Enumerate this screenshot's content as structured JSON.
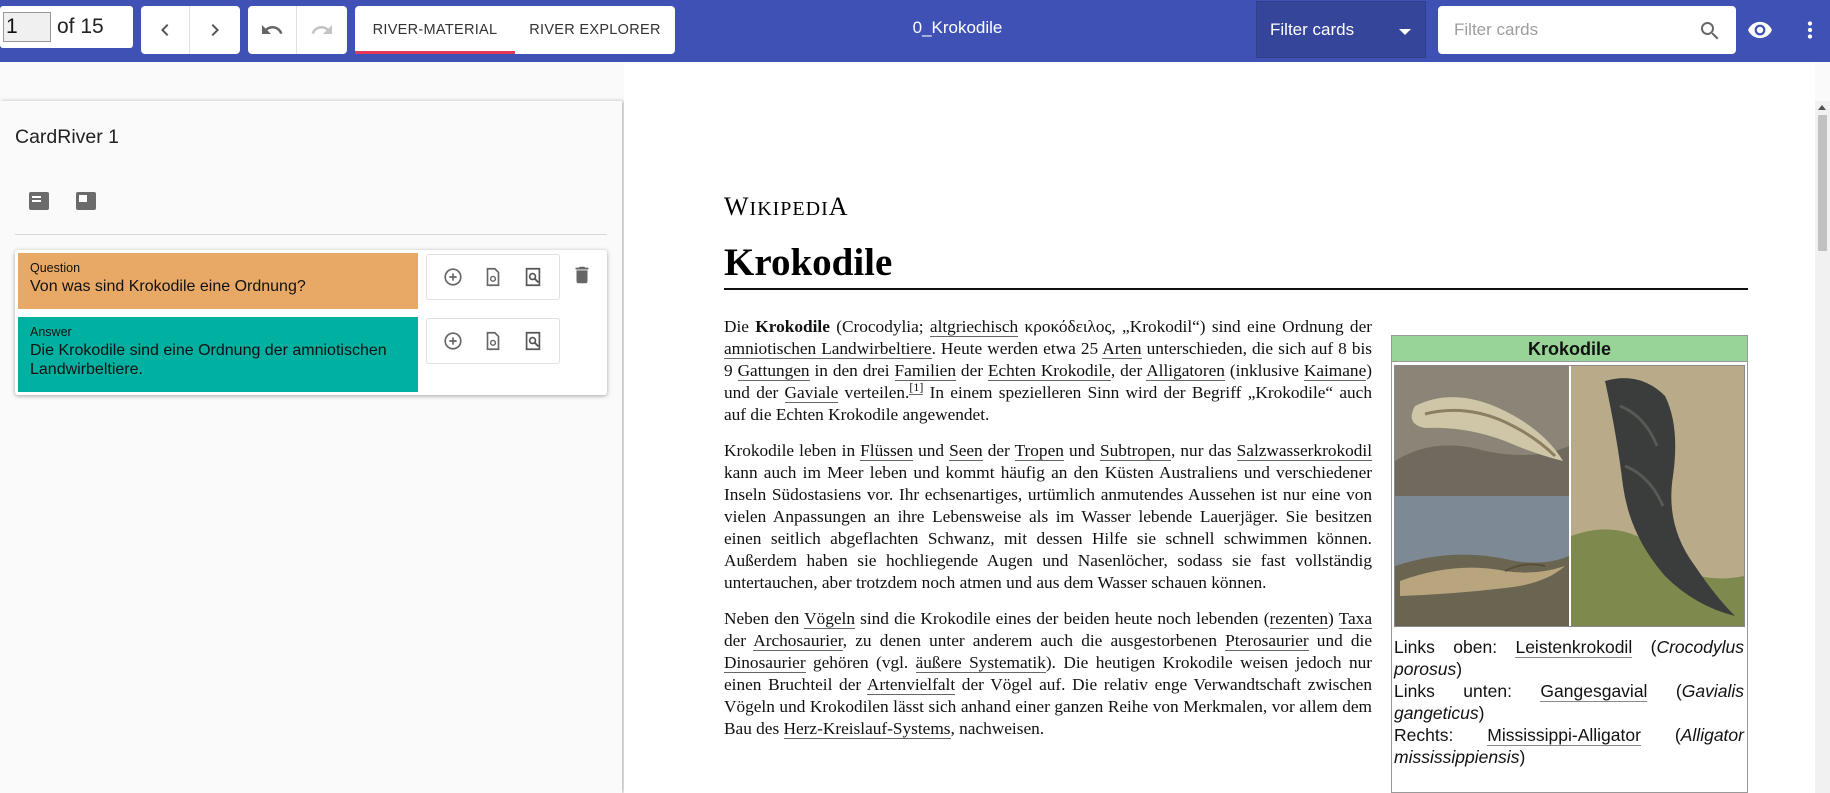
{
  "toolbar": {
    "page_current": "1",
    "page_total_label": "of 15",
    "tabs": [
      {
        "label": "RIVER-MATERIAL",
        "active": true
      },
      {
        "label": "RIVER EXPLORER",
        "active": false
      }
    ],
    "document_title": "0_Krokodile",
    "filter_select_value": "Filter cards",
    "filter_input_placeholder": "Filter cards",
    "icons": [
      "chevron-left-icon",
      "chevron-right-icon",
      "undo-icon",
      "redo-icon",
      "search-icon",
      "eye-icon",
      "more-vert-icon"
    ],
    "accent_color": "#3f51b5",
    "active_tab_color": "#e53955"
  },
  "left_panel": {
    "title": "CardRiver 1",
    "card": {
      "question_label": "Question",
      "question_text": "Von was sind Krokodile eine Ordnung?",
      "answer_label": "Answer",
      "answer_text": "Die Krokodile sind eine Ordnung der amniotischen Landwirbeltiere.",
      "question_color": "#e8a966",
      "answer_color": "#00b0a0"
    }
  },
  "document": {
    "logo": "Wikipedia",
    "heading": "Krokodile",
    "paragraphs": {
      "p1": {
        "t0": "Die ",
        "bold": "Krokodile",
        "t1": " (Crocodylia; ",
        "l1": "altgriechisch",
        "t2": " κροκόδειλος, „Krokodil“) sind eine Ordnung der ",
        "l2": "amniotischen Landwirbeltiere",
        "t3": ". Heute werden etwa 25 ",
        "l3": "Arten",
        "t4": " unterschieden, die sich auf 8 bis 9 ",
        "l4": "Gattungen",
        "t5": " in den drei ",
        "l5": "Familien",
        "t6": " der ",
        "l6": "Echten Krokodile",
        "t7": ", der ",
        "l7": "Alligatoren",
        "t8": " (inklusive ",
        "l8": "Kaimane",
        "t9": ") und der ",
        "l9": "Gaviale",
        "t10": " verteilen.",
        "ref": "[1]",
        "t11": " In einem spezielleren Sinn wird der Begriff „Krokodile“ auch auf die Echten Krokodile angewendet."
      },
      "p2": {
        "t0": "Krokodile leben in ",
        "l1": "Flüssen",
        "t1": " und ",
        "l2": "Seen",
        "t2": " der ",
        "l3": "Tropen",
        "t3": " und ",
        "l4": "Subtropen",
        "t4": ", nur das ",
        "l5": "Salzwasserkrokodil",
        "t5": " kann auch im Meer leben und kommt häufig an den Küsten Australiens und verschiedener Inseln Südostasiens vor. Ihr echsenartiges, urtümlich anmutendes Aussehen ist nur eine von vielen Anpassungen an ihre Lebensweise als im Wasser lebende Lauerjäger. Sie besitzen einen seitlich abgeflachten Schwanz, mit dessen Hilfe sie schnell schwimmen können. Außerdem haben sie hochliegende Augen und Nasenlöcher, sodass sie fast vollständig untertauchen, aber trotzdem noch atmen und aus dem Wasser schauen können."
      },
      "p3": {
        "t0": "Neben den ",
        "l1": "Vögeln",
        "t1": " sind die Krokodile eines der beiden heute noch lebenden (",
        "l2": "rezenten",
        "t2": ") ",
        "l3": "Taxa",
        "t3": " der ",
        "l4": "Archosaurier",
        "t4": ", zu denen unter anderem auch die ausgestorbenen ",
        "l5": "Pterosaurier",
        "t5": " und die ",
        "l6": "Dinosaurier",
        "t6": " gehören (vgl. ",
        "l7": "äußere Systematik",
        "t7": "). Die heutigen Krokodile weisen jedoch nur einen Bruchteil der ",
        "l8": "Artenvielfalt",
        "t8": " der Vögel auf. Die relativ enge Verwandtschaft zwischen Vögeln und Krokodilen lässt sich anhand einer ganzen Reihe von Merkmalen, vor allem dem Bau des ",
        "l9": "Herz-Kreislauf-Systems",
        "t9": ", nachweisen."
      }
    },
    "infobox": {
      "title": "Krokodile",
      "header_color": "#98d498",
      "caption": {
        "c1_pre": "Links oben: ",
        "c1_link": "Leistenkrokodil",
        "c1_sci": "Crocodylus porosus",
        "c2_pre": "Links unten: ",
        "c2_link": "Gangesgavial",
        "c2_sci": "Gavialis gangeticus",
        "c3_pre": "Rechts: ",
        "c3_link": "Mississippi-Alligator",
        "c3_sci": "Alligator mississippiensis"
      }
    }
  }
}
